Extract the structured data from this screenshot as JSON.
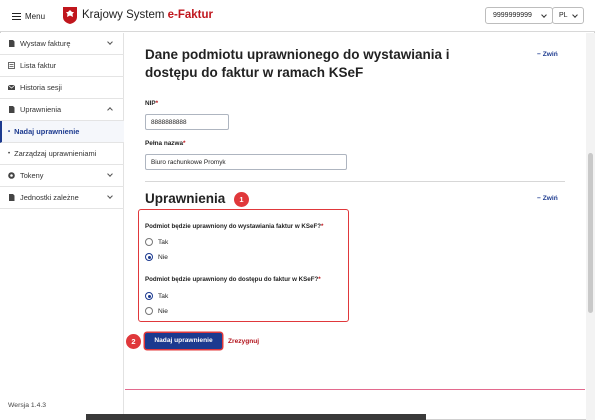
{
  "header": {
    "menu_label": "Menu",
    "title_plain": "Krajowy System ",
    "title_brand": "e-Faktur",
    "nip_value": "9999999999",
    "language": "PL"
  },
  "sidebar": {
    "items": [
      {
        "label": "Wystaw fakturę",
        "icon": "document-icon",
        "expandable": true
      },
      {
        "label": "Lista faktur",
        "icon": "list-icon",
        "expandable": false
      },
      {
        "label": "Historia sesji",
        "icon": "envelope-icon",
        "expandable": false
      },
      {
        "label": "Uprawnienia",
        "icon": "document-icon",
        "expandable": true
      },
      {
        "label": "Nadaj uprawnienie",
        "icon": "bullet",
        "active": true
      },
      {
        "label": "Zarządzaj uprawnieniami",
        "icon": "bullet"
      },
      {
        "label": "Tokeny",
        "icon": "token-icon",
        "expandable": true
      },
      {
        "label": "Jednostki zależne",
        "icon": "document-icon",
        "expandable": true
      }
    ],
    "version": "Wersja 1.4.3"
  },
  "main": {
    "section1": {
      "title_line1": "Dane podmiotu uprawnionego do wystawiania i",
      "title_line2": "dostępu do faktur w ramach KSeF",
      "collapse_label": "Zwiń",
      "nip_label": "NIP",
      "nip_value": "8888888888",
      "name_label": "Pełna nazwa",
      "name_value": "Biuro rachunkowe Promyk"
    },
    "section2": {
      "title": "Uprawnienia",
      "collapse_label": "Zwiń",
      "q1": "Podmiot będzie uprawniony do wystawiania faktur w KSeF?",
      "q1_options": [
        "Tak",
        "Nie"
      ],
      "q1_selected": "Nie",
      "q2": "Podmiot będzie uprawniony do dostępu do faktur w KSeF?",
      "q2_options": [
        "Tak",
        "Nie"
      ],
      "q2_selected": "Tak"
    },
    "submit_label": "Nadaj uprawnienie",
    "cancel_label": "Zrezygnuj",
    "badges": [
      "1",
      "2"
    ],
    "required_mark": "*"
  },
  "colors": {
    "brand_red": "#c0161d",
    "primary_blue": "#1c3a8f",
    "highlight_red": "#e0383b"
  }
}
